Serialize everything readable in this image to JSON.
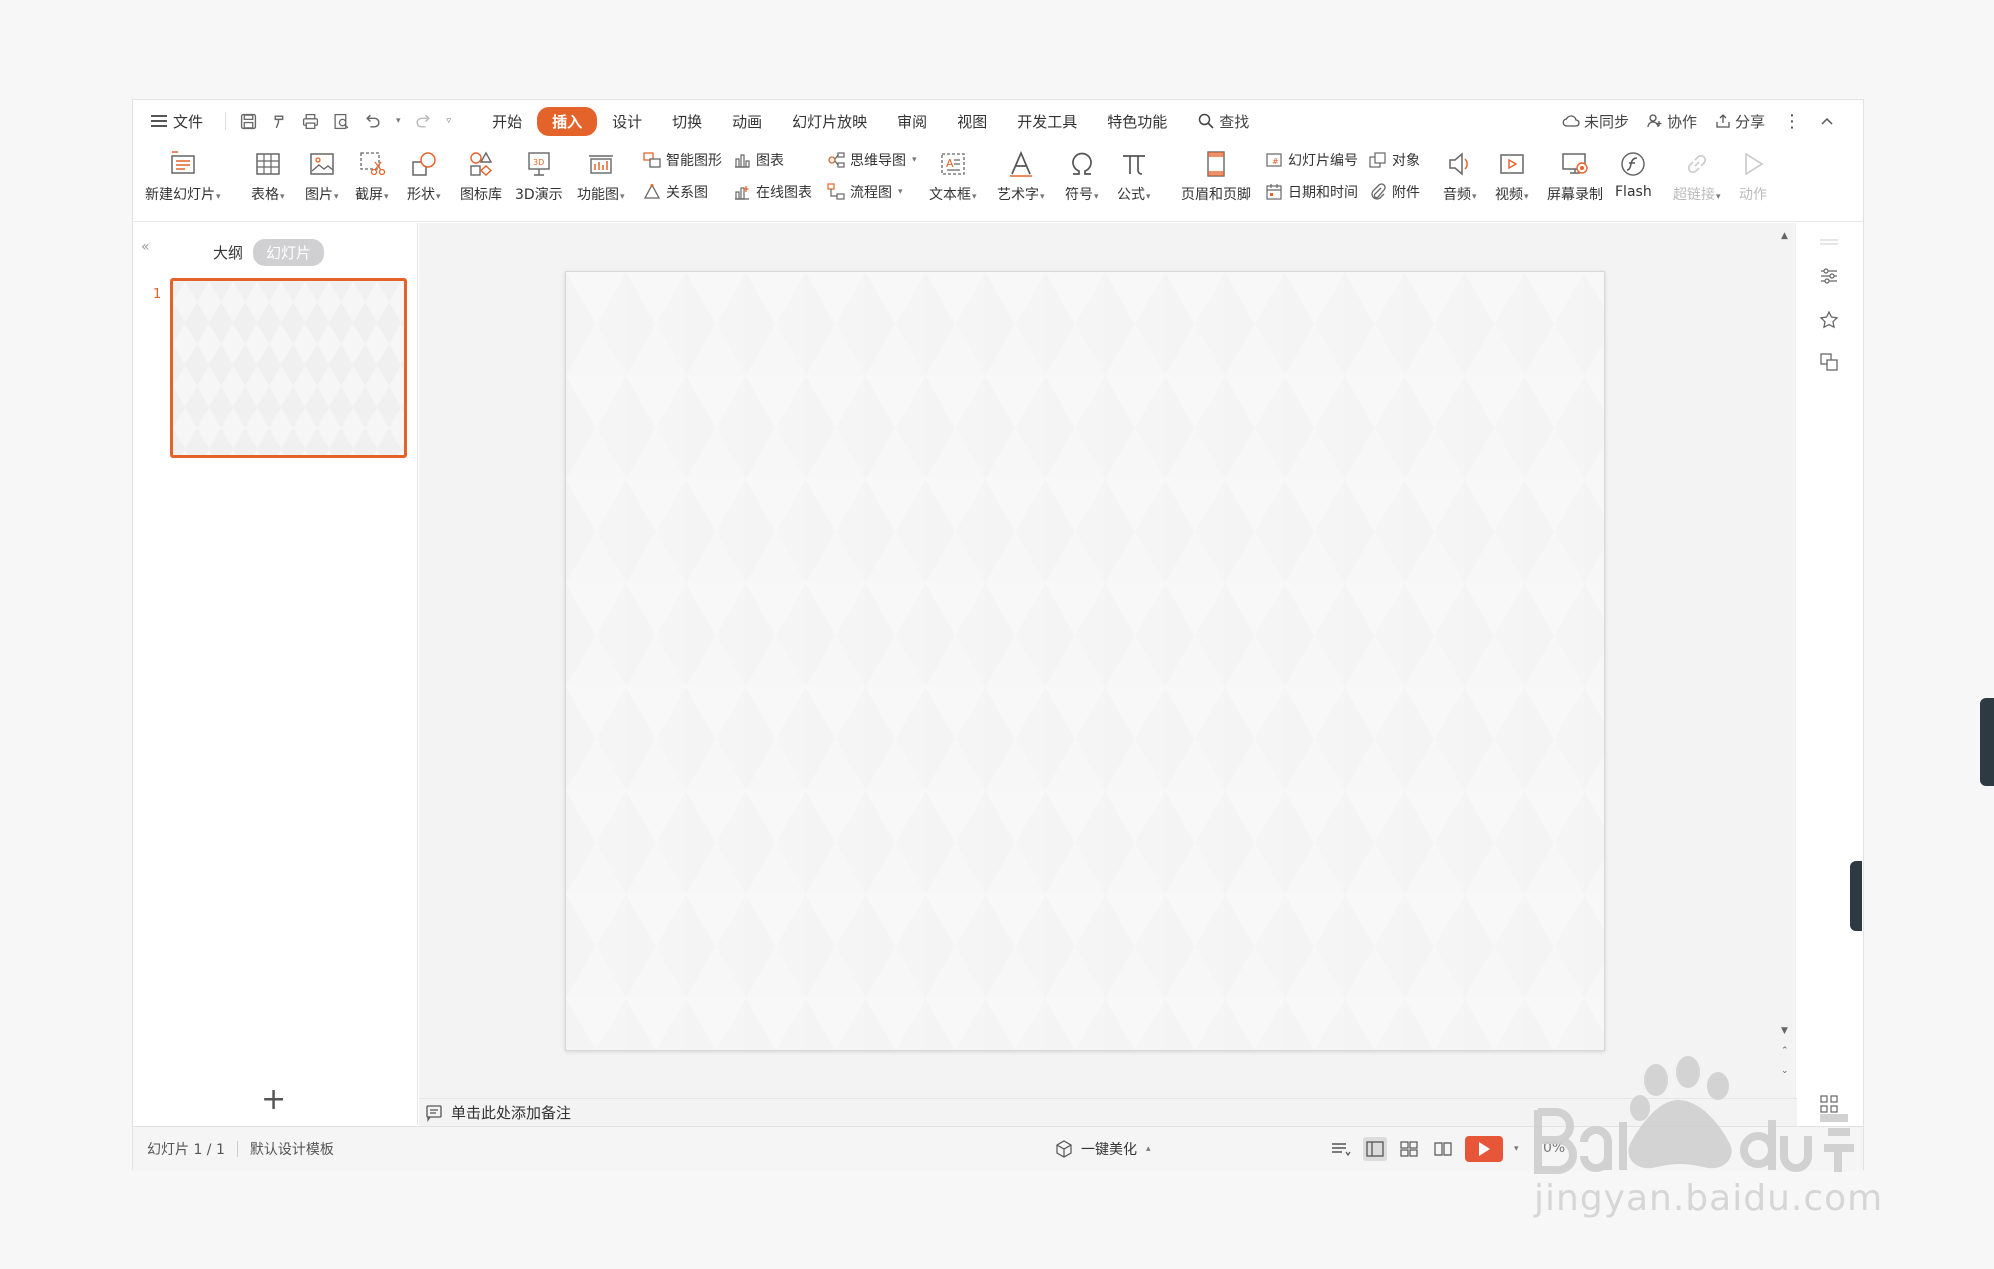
{
  "menu": {
    "file": "文件",
    "tabs": [
      "开始",
      "插入",
      "设计",
      "切换",
      "动画",
      "幻灯片放映",
      "审阅",
      "视图",
      "开发工具",
      "特色功能"
    ],
    "active_tab": "插入",
    "search": "查找",
    "right": {
      "sync": "未同步",
      "collab": "协作",
      "share": "分享"
    }
  },
  "ribbon": {
    "new_slide": "新建幻灯片",
    "table": "表格",
    "picture": "图片",
    "screenshot": "截屏",
    "shape": "形状",
    "icon_lib": "图标库",
    "demo3d": "3D演示",
    "func_chart": "功能图",
    "smart_shape": "智能图形",
    "chart": "图表",
    "mindmap": "思维导图",
    "relation": "关系图",
    "online_chart": "在线图表",
    "flowchart": "流程图",
    "textbox": "文本框",
    "wordart": "艺术字",
    "symbol": "符号",
    "formula": "公式",
    "header_footer": "页眉和页脚",
    "slide_number": "幻灯片编号",
    "object": "对象",
    "datetime": "日期和时间",
    "attachment": "附件",
    "audio": "音频",
    "video": "视频",
    "screen_record": "屏幕录制",
    "flash": "Flash",
    "hyperlink": "超链接",
    "action": "动作"
  },
  "left_panel": {
    "tab_outline": "大纲",
    "tab_slides": "幻灯片",
    "thumb_number": "1"
  },
  "notes": {
    "placeholder": "单击此处添加备注"
  },
  "status": {
    "slide_count": "幻灯片 1 / 1",
    "template": "默认设计模板",
    "beautify": "一键美化",
    "zoom": "0%"
  },
  "watermark": {
    "text": "jingyan.baidu.com"
  },
  "colors": {
    "accent": "#e4632a",
    "play": "#e8563a"
  }
}
